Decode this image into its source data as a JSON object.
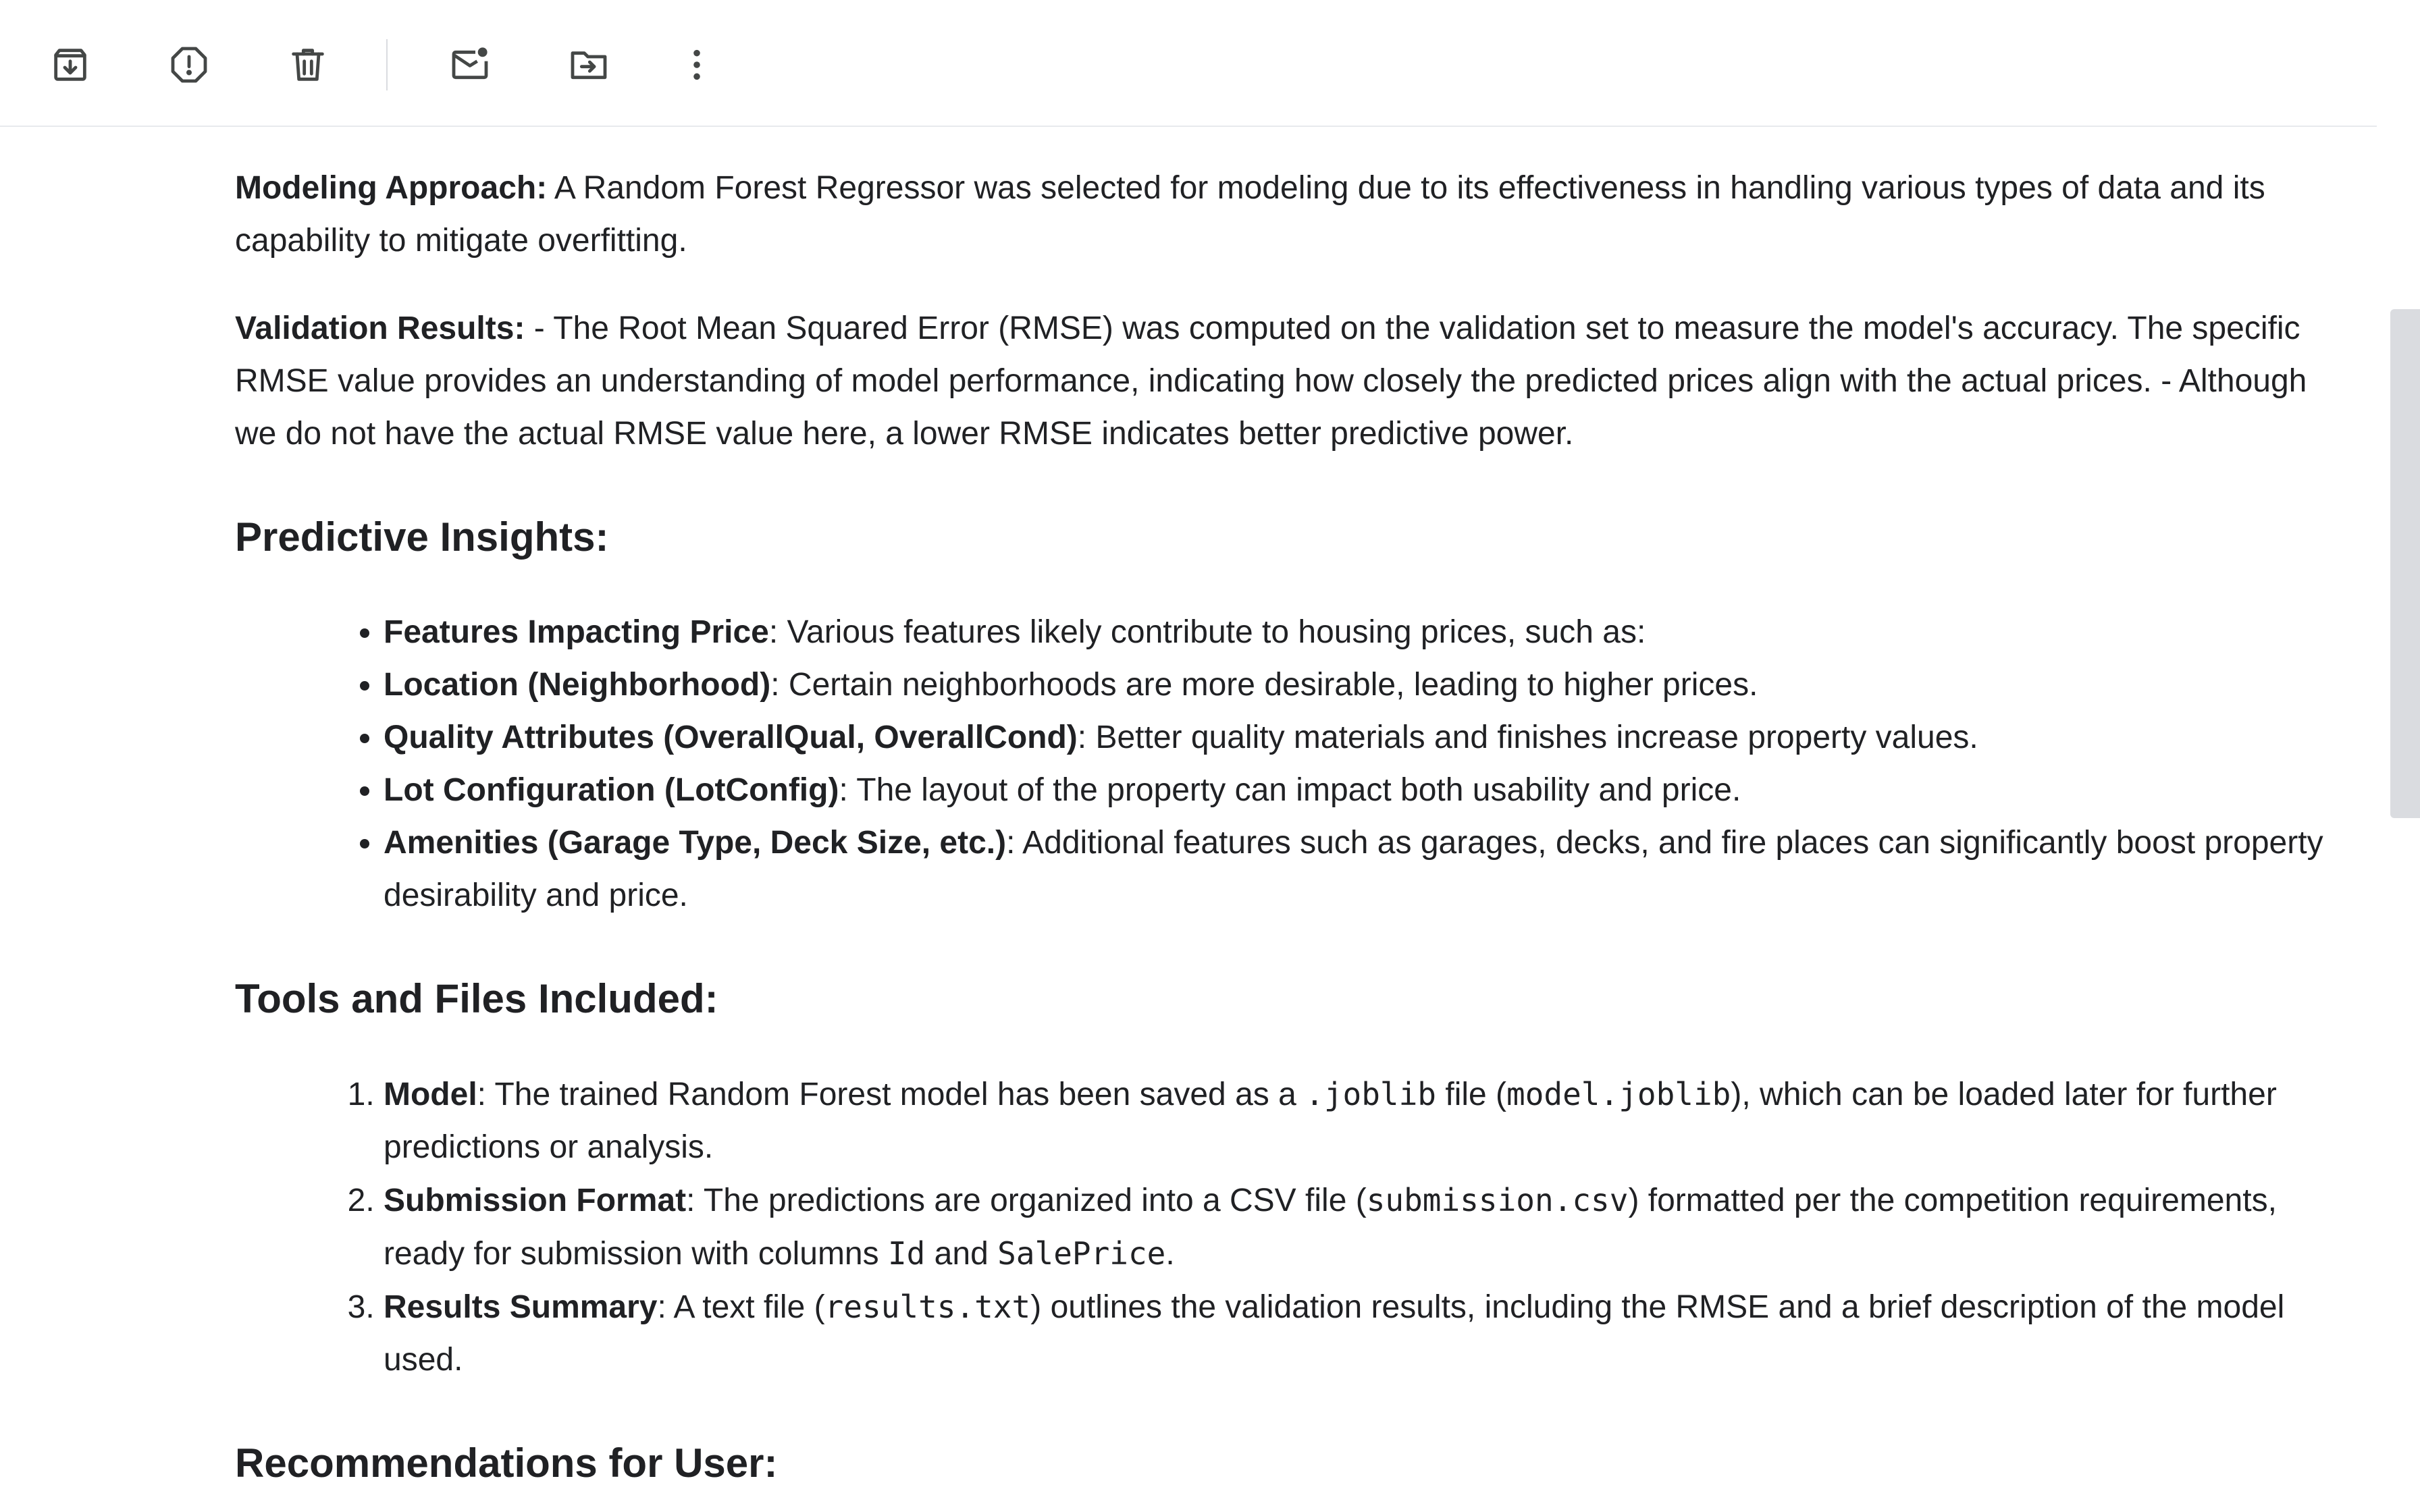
{
  "toolbar": {
    "buttons": [
      {
        "name": "archive",
        "icon": "archive-icon"
      },
      {
        "name": "report-spam",
        "icon": "report-spam-icon"
      },
      {
        "name": "delete",
        "icon": "trash-icon"
      },
      {
        "name": "mark-unread",
        "icon": "mark-unread-icon"
      },
      {
        "name": "move-to",
        "icon": "move-to-folder-icon"
      },
      {
        "name": "more",
        "icon": "more-vert-icon"
      }
    ],
    "icon_color": "#444746"
  },
  "content": {
    "modeling": {
      "label": "Modeling Approach:",
      "text": " A Random Forest Regressor was selected for modeling due to its effectiveness in handling various types of data and its capability to mitigate overfitting."
    },
    "validation": {
      "label": "Validation Results:",
      "text": " - The Root Mean Squared Error (RMSE) was computed on the validation set to measure the model's accuracy. The specific RMSE value provides an understanding of model performance, indicating how closely the predicted prices align with the actual prices. - Although we do not have the actual RMSE value here, a lower RMSE indicates better predictive power."
    },
    "predictive_heading": "Predictive Insights:",
    "insights": [
      {
        "label": "Features Impacting Price",
        "text": ": Various features likely contribute to housing prices, such as:"
      },
      {
        "label": "Location (Neighborhood)",
        "text": ": Certain neighborhoods are more desirable, leading to higher prices."
      },
      {
        "label": "Quality Attributes (OverallQual, OverallCond)",
        "text": ": Better quality materials and finishes increase property values."
      },
      {
        "label": "Lot Configuration (LotConfig)",
        "text": ": The layout of the property can impact both usability and price."
      },
      {
        "label": "Amenities (Garage Type, Deck Size, etc.)",
        "text": ": Additional features such as garages, decks, and fire places can significantly boost property desirability and price."
      }
    ],
    "tools_heading": "Tools and Files Included:",
    "tools": {
      "model": {
        "label": "Model",
        "t1": ": The trained Random Forest model has been saved as a ",
        "c1": ".joblib",
        "t2": " file (",
        "c2": "model.joblib",
        "t3": "), which can be loaded later for further predictions or analysis."
      },
      "submission": {
        "label": "Submission Format",
        "t1": ": The predictions are organized into a CSV file (",
        "c1": "submission.csv",
        "t2": ") formatted per the competition requirements, ready for submission with columns ",
        "c2": "Id",
        "t3": " and ",
        "c3": "SalePrice",
        "t4": "."
      },
      "results": {
        "label": "Results Summary",
        "t1": ": A text file (",
        "c1": "results.txt",
        "t2": ") outlines the validation results, including the RMSE and a brief description of the model used."
      }
    },
    "recommendations_heading": "Recommendations for User:"
  }
}
